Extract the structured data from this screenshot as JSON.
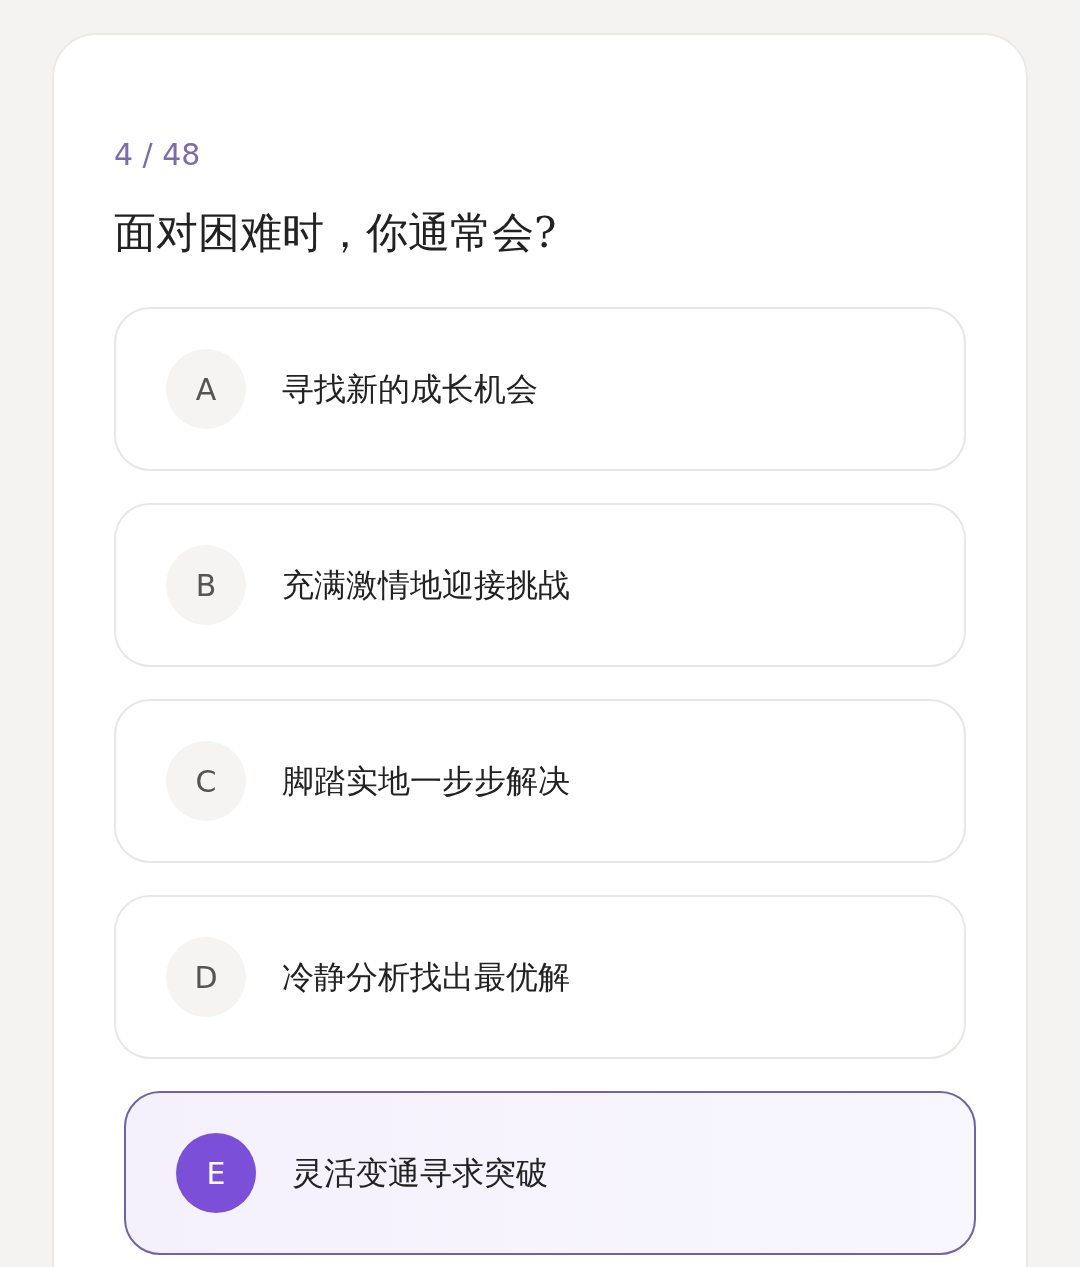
{
  "progress": "4 / 48",
  "question": "面对困难时，你通常会?",
  "options": [
    {
      "letter": "A",
      "text": "寻找新的成长机会",
      "selected": false
    },
    {
      "letter": "B",
      "text": "充满激情地迎接挑战",
      "selected": false
    },
    {
      "letter": "C",
      "text": "脚踏实地一步步解决",
      "selected": false
    },
    {
      "letter": "D",
      "text": "冷静分析找出最优解",
      "selected": false
    },
    {
      "letter": "E",
      "text": "灵活变通寻求突破",
      "selected": true
    }
  ]
}
